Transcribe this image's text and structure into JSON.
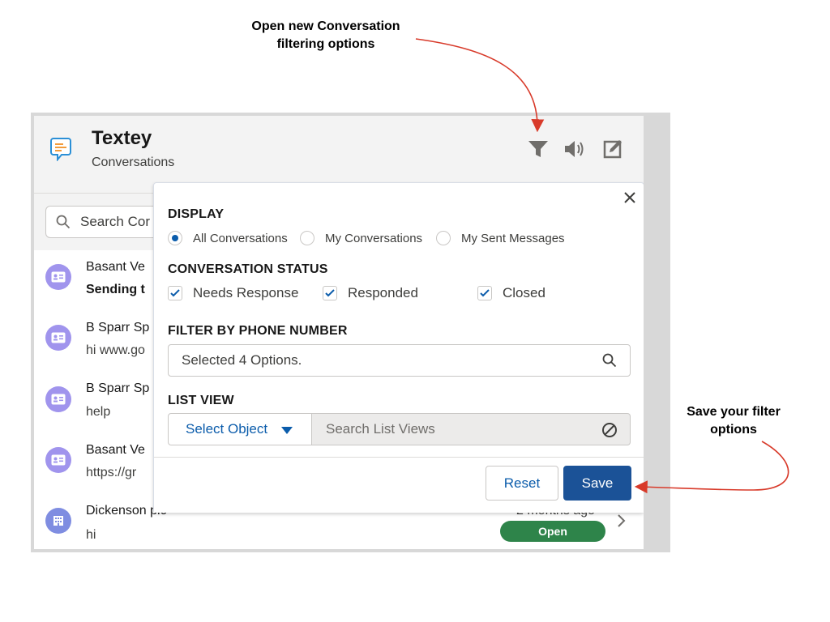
{
  "annotations": {
    "top_line1": "Open new Conversation",
    "top_line2": "filtering options",
    "right_line1": "Save your filter",
    "right_line2": "options",
    "arrow_color": "#d83a2a"
  },
  "app": {
    "title": "Textey",
    "subtitle": "Conversations",
    "logo_icon": "chat-bubble-icon",
    "header_icons": [
      "filter-icon",
      "speaker-icon",
      "compose-icon"
    ]
  },
  "search": {
    "placeholder": "Search Cor"
  },
  "conversations": [
    {
      "name": "Basant Ve",
      "message": "Sending t",
      "message_bold": true,
      "avatar_icon": "contact-card-icon"
    },
    {
      "name": "B Sparr Sp",
      "message": "hi www.go",
      "avatar_icon": "contact-card-icon"
    },
    {
      "name": "B Sparr Sp",
      "message": "help",
      "avatar_icon": "contact-card-icon"
    },
    {
      "name": "Basant Ve",
      "message": "https://gr",
      "avatar_icon": "contact-card-icon"
    },
    {
      "name": "Dickenson plc",
      "message": "hi",
      "time": "2 months ago",
      "status": "Open",
      "avatar_icon": "building-icon"
    }
  ],
  "filter_panel": {
    "display_label": "DISPLAY",
    "display_options": [
      {
        "label": "All Conversations",
        "selected": true
      },
      {
        "label": "My Conversations",
        "selected": false
      },
      {
        "label": "My Sent Messages",
        "selected": false
      }
    ],
    "status_label": "CONVERSATION STATUS",
    "status_options": [
      {
        "label": "Needs Response",
        "checked": true
      },
      {
        "label": "Responded",
        "checked": true
      },
      {
        "label": "Closed",
        "checked": true
      }
    ],
    "phone_label": "FILTER BY PHONE NUMBER",
    "phone_value": "Selected 4 Options.",
    "listview_label": "LIST VIEW",
    "select_object": "Select Object",
    "listview_placeholder": "Search List Views",
    "reset_label": "Reset",
    "save_label": "Save"
  },
  "colors": {
    "accent": "#0b5cab",
    "save_button": "#1b5297",
    "status_open": "#2e844a",
    "avatar": "#a094ed"
  }
}
